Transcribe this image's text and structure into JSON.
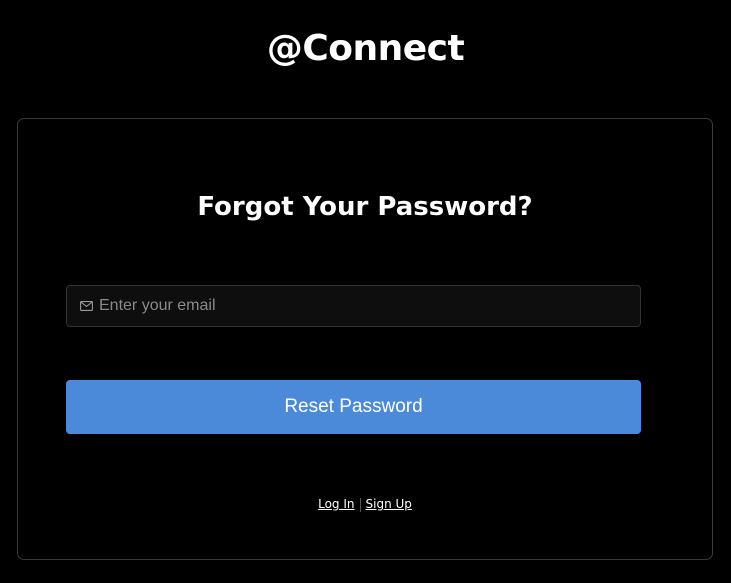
{
  "brand": {
    "title": "@Connect"
  },
  "form": {
    "heading": "Forgot Your Password?",
    "email": {
      "placeholder": "Enter your email",
      "value": "",
      "icon": "mail-icon"
    },
    "submit_label": "Reset Password"
  },
  "links": {
    "login_label": "Log In",
    "signup_label": "Sign Up"
  },
  "colors": {
    "background": "#000000",
    "accent": "#4a8ad8",
    "card_border": "#3a3a3a",
    "input_bg": "#0e0e0e"
  }
}
